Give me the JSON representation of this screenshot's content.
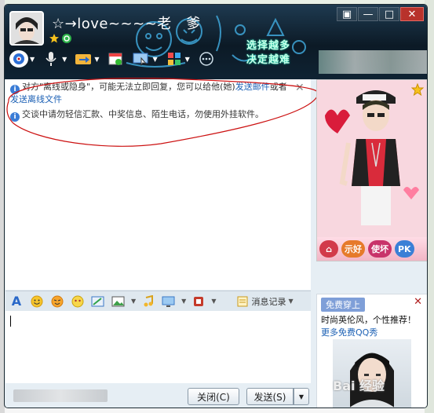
{
  "window": {
    "nickname": "☆→love~~~~老　爹",
    "slogan_line1": "选择越多",
    "slogan_line2": "决定越难"
  },
  "window_controls": [
    "▣",
    "—",
    "□",
    "✕"
  ],
  "notices": {
    "offline_part1": "对方\"离线或隐身\"，可能无法立即回复，您可以给他(她)",
    "offline_link1": "发送邮件",
    "offline_part2": "或者",
    "offline_link2": "发送离线文件",
    "safety": "交谈中请勿轻信汇款、中奖信息、陌生电话，勿使用外挂软件。",
    "close_symbol": "✕"
  },
  "qqshow": {
    "btn_home": "⌂",
    "btn_1": "示好",
    "btn_2": "使坏",
    "btn_3": "PK"
  },
  "input_toolbar": {
    "font": "A",
    "message_log": "消息记录"
  },
  "buttons": {
    "close": "关闭(C)",
    "send": "发送(S)",
    "send_dropdown": "▼"
  },
  "ad": {
    "free_label": "免费穿上",
    "line1": "时尚英伦风，个性推荐！",
    "line2": "更多免费QQ秀",
    "close": "✕"
  },
  "watermark": "Bai 经验",
  "colors": {
    "title_bg": "#0f2333",
    "link": "#1a5fb4",
    "annotation": "#cc1111"
  }
}
